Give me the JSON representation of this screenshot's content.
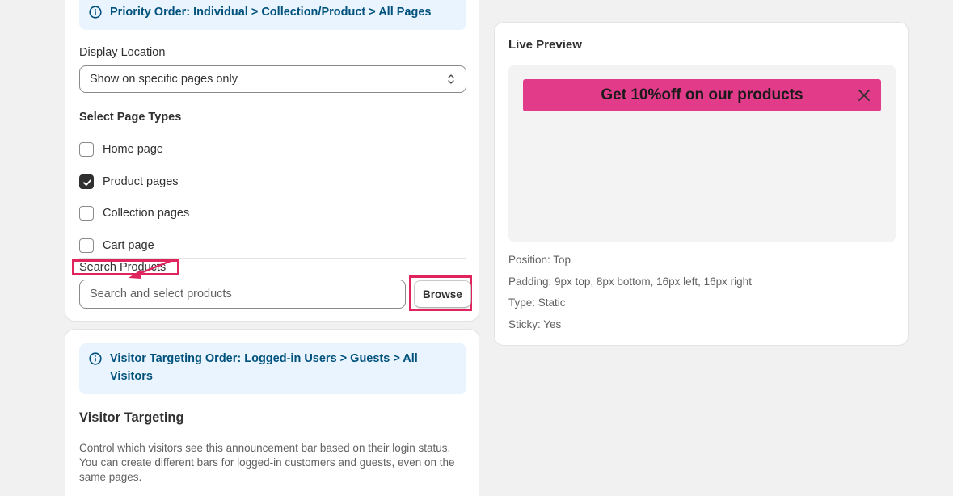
{
  "display_card": {
    "priority_banner": "Priority Order: Individual > Collection/Product > All Pages",
    "display_location_label": "Display Location",
    "display_location_value": "Show on specific pages only",
    "page_types_label": "Select Page Types",
    "page_types": [
      {
        "label": "Home page",
        "checked": false
      },
      {
        "label": "Product pages",
        "checked": true
      },
      {
        "label": "Collection pages",
        "checked": false
      },
      {
        "label": "Cart page",
        "checked": false
      }
    ],
    "search_products_label": "Search Products",
    "search_placeholder": "Search and select products",
    "browse_label": "Browse"
  },
  "visitor_card": {
    "banner": "Visitor Targeting Order: Logged-in Users > Guests > All Visitors",
    "title": "Visitor Targeting",
    "description": "Control which visitors see this announcement bar based on their login status. You can create different bars for logged-in customers and guests, even on the same pages."
  },
  "preview_card": {
    "title": "Live Preview",
    "announcement_text": "Get 10%off on our products",
    "announcement_bg": "#e23b8a",
    "position": "Position: Top",
    "padding": "Padding: 9px top, 8px bottom, 16px left, 16px right",
    "type": "Type: Static",
    "sticky": "Sticky: Yes"
  },
  "colors": {
    "highlight": "#e0245e",
    "banner_bg": "#eaf4ff",
    "banner_text": "#00527c"
  }
}
